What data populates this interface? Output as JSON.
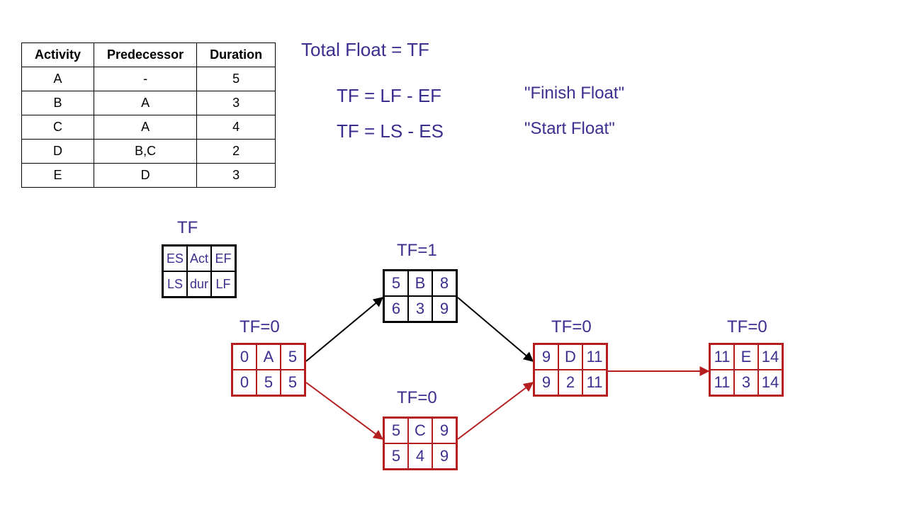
{
  "table": {
    "headers": [
      "Activity",
      "Predecessor",
      "Duration"
    ],
    "rows": [
      [
        "A",
        "-",
        "5"
      ],
      [
        "B",
        "A",
        "3"
      ],
      [
        "C",
        "A",
        "4"
      ],
      [
        "D",
        "B,C",
        "2"
      ],
      [
        "E",
        "D",
        "3"
      ]
    ]
  },
  "formulas": {
    "title": "Total Float = TF",
    "line1_lhs": "TF = LF - EF",
    "line1_rhs": "\"Finish Float\"",
    "line2_lhs": "TF = LS - ES",
    "line2_rhs": "\"Start Float\""
  },
  "legend": {
    "tf": "TF",
    "cells": [
      "ES",
      "Act",
      "EF",
      "LS",
      "dur",
      "LF"
    ]
  },
  "nodes": {
    "A": {
      "tf": "TF=0",
      "cells": [
        "0",
        "A",
        "5",
        "0",
        "5",
        "5"
      ],
      "critical": true
    },
    "B": {
      "tf": "TF=1",
      "cells": [
        "5",
        "B",
        "8",
        "6",
        "3",
        "9"
      ],
      "critical": false
    },
    "C": {
      "tf": "TF=0",
      "cells": [
        "5",
        "C",
        "9",
        "5",
        "4",
        "9"
      ],
      "critical": true
    },
    "D": {
      "tf": "TF=0",
      "cells": [
        "9",
        "D",
        "11",
        "9",
        "2",
        "11"
      ],
      "critical": true
    },
    "E": {
      "tf": "TF=0",
      "cells": [
        "11",
        "E",
        "14",
        "11",
        "3",
        "14"
      ],
      "critical": true
    }
  },
  "chart_data": {
    "type": "table",
    "title": "Activity-on-Node network with Total Float",
    "legend": {
      "top_row": [
        "ES",
        "Activity",
        "EF"
      ],
      "bottom_row": [
        "LS",
        "Duration",
        "LF"
      ]
    },
    "activities": [
      {
        "id": "A",
        "predecessors": [],
        "duration": 5,
        "ES": 0,
        "EF": 5,
        "LS": 0,
        "LF": 5,
        "TF": 0,
        "critical": true
      },
      {
        "id": "B",
        "predecessors": [
          "A"
        ],
        "duration": 3,
        "ES": 5,
        "EF": 8,
        "LS": 6,
        "LF": 9,
        "TF": 1,
        "critical": false
      },
      {
        "id": "C",
        "predecessors": [
          "A"
        ],
        "duration": 4,
        "ES": 5,
        "EF": 9,
        "LS": 5,
        "LF": 9,
        "TF": 0,
        "critical": true
      },
      {
        "id": "D",
        "predecessors": [
          "B",
          "C"
        ],
        "duration": 2,
        "ES": 9,
        "EF": 11,
        "LS": 9,
        "LF": 11,
        "TF": 0,
        "critical": true
      },
      {
        "id": "E",
        "predecessors": [
          "D"
        ],
        "duration": 3,
        "ES": 11,
        "EF": 14,
        "LS": 11,
        "LF": 14,
        "TF": 0,
        "critical": true
      }
    ],
    "formulas": [
      "TF = LF - EF (Finish Float)",
      "TF = LS - ES (Start Float)"
    ],
    "critical_path": [
      "A",
      "C",
      "D",
      "E"
    ]
  }
}
